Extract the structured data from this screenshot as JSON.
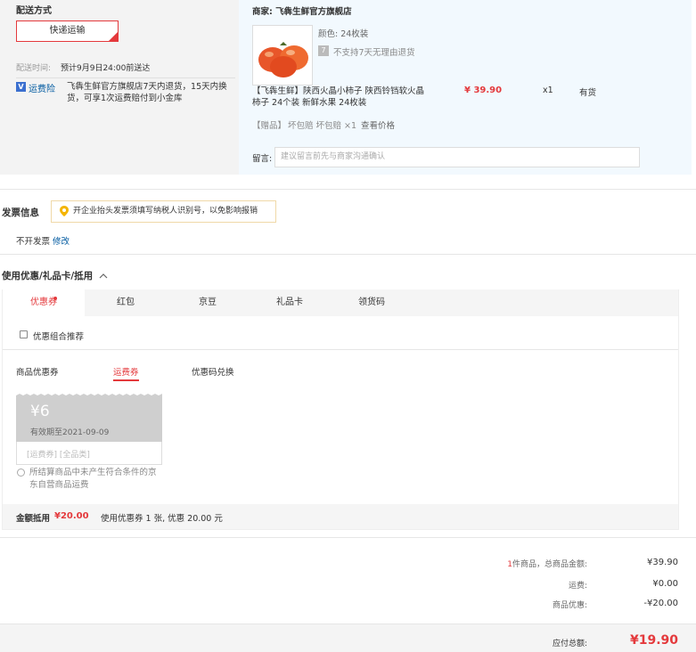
{
  "shipping": {
    "title": "配送方式",
    "method_label": "快递运输",
    "time_label": "配送时间:",
    "time_value": "预计9月9日24:00前送达",
    "insurance_badge": "运费险",
    "insurance_text": "飞犇生鲜官方旗舰店7天内退货，15天内换货，可享1次运费赔付到小金库"
  },
  "store": {
    "name": "商家: 飞犇生鲜官方旗舰店",
    "color_label": "颜色: 24枚装",
    "no_return": "不支持7天无理由退货",
    "product_title": "【飞犇生鲜】陕西火晶小柿子 陕西铃铛软火晶柿子 24个装 新鲜水果 24枚装",
    "price": "¥ 39.90",
    "qty": "x1",
    "stock": "有货",
    "gift_tag": "【赠品】",
    "gift_text": "坏包赔 坏包赔 ×1",
    "gift_link": "查看价格",
    "note_label": "留言:",
    "note_placeholder": "建议留言前先与商家沟通确认"
  },
  "invoice": {
    "title": "发票信息",
    "tip": "开企业抬头发票须填写纳税人识别号，以免影响报销",
    "value": "不开发票",
    "edit": "修改"
  },
  "discount": {
    "title": "使用优惠/礼品卡/抵用",
    "tabs": [
      "优惠券",
      "红包",
      "京豆",
      "礼品卡",
      "领货码"
    ],
    "combo_label": "优惠组合推荐",
    "subtabs": [
      "商品优惠券",
      "运费券",
      "优惠码兑换"
    ],
    "coupon": {
      "amount": "¥6",
      "valid": "有效期至2021-09-09",
      "tags": "[运费券] [全品类]",
      "note": "所结算商品中未产生符合条件的京东自营商品运费"
    },
    "summary_label": "金额抵用",
    "summary_amount": "¥20.00",
    "summary_text": "使用优惠券 1 张, 优惠 20.00 元"
  },
  "totals": {
    "count": "1",
    "items_label": "件商品，总商品金额:",
    "items_value": "¥39.90",
    "freight_label": "运费:",
    "freight_value": "¥0.00",
    "discount_label": "商品优惠:",
    "discount_value": "-¥20.00",
    "payable_label": "应付总额:",
    "payable_value": "¥19.90"
  },
  "colors": {
    "accent": "#e4393c",
    "link": "#005aa0",
    "store_bg": "#f2f9fe",
    "left_bg": "#f3f3f3"
  }
}
